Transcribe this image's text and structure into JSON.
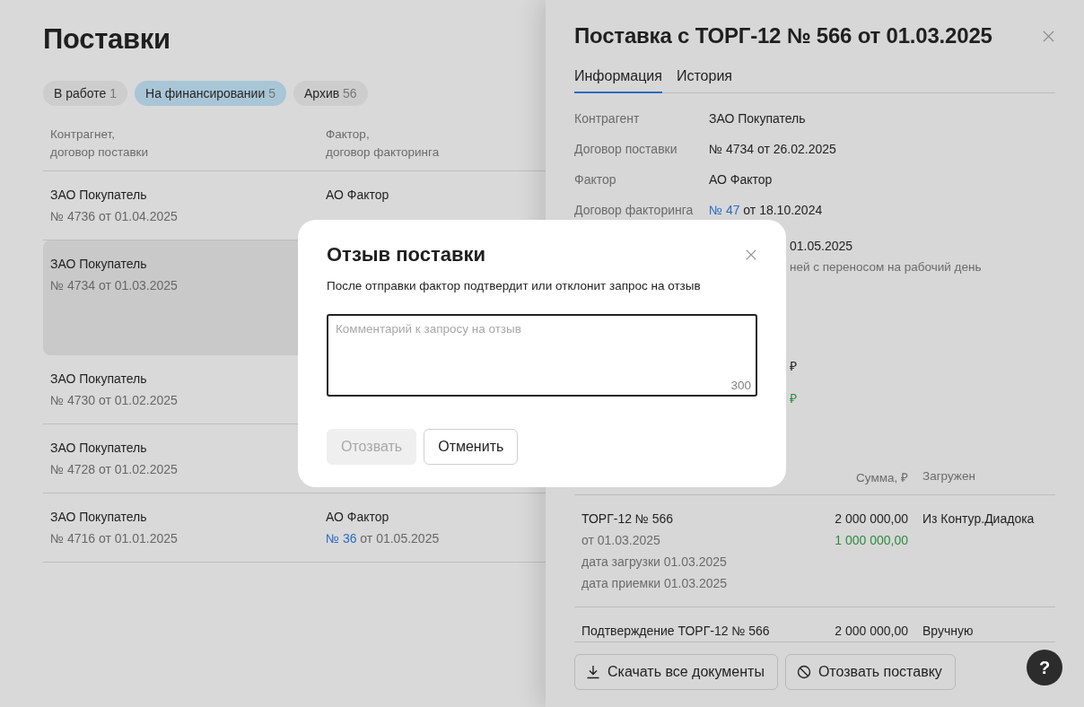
{
  "page": {
    "title": "Поставки"
  },
  "filters": [
    {
      "label": "В работе",
      "count": "1",
      "selected": false
    },
    {
      "label": "На финансировании",
      "count": "5",
      "selected": true
    },
    {
      "label": "Архив",
      "count": "56",
      "selected": false
    }
  ],
  "table": {
    "columns": [
      "Контрагнет,\nдоговор поставки",
      "Фактор,\nдоговор факторинга"
    ],
    "rows": [
      {
        "counterparty": "ЗАО Покупатель",
        "contract": "№ 4736 от 01.04.2025",
        "factor": "АО Фактор",
        "selected": false
      },
      {
        "counterparty": "ЗАО Покупатель",
        "contract": "№ 4734 от 01.03.2025",
        "selected": true
      },
      {
        "counterparty": "ЗАО Покупатель",
        "contract": "№ 4730 от 01.02.2025",
        "selected": false
      },
      {
        "counterparty": "ЗАО Покупатель",
        "contract": "№ 4728 от 01.02.2025",
        "selected": false
      },
      {
        "counterparty": "ЗАО Покупатель",
        "contract": "№ 4716 от 01.01.2025",
        "factor": "АО Фактор",
        "factoring_link": "№ 36",
        "factoring_rest": " от 01.05.2025",
        "selected": false
      }
    ]
  },
  "drawer": {
    "title": "Поставка с ТОРГ-12 № 566 от 01.03.2025",
    "tabs": [
      {
        "label": "Информация",
        "selected": true
      },
      {
        "label": "История",
        "selected": false
      }
    ],
    "fields": [
      {
        "label": "Контрагент",
        "value": "ЗАО Покупатель"
      },
      {
        "label": "Договор поставки",
        "value": "№ 4734 от 26.02.2025"
      },
      {
        "label": "Фактор",
        "value": "АО Фактор"
      },
      {
        "label": "Договор факторинга",
        "link": "№ 47",
        "value": " от 18.10.2024"
      }
    ],
    "fragments": [
      {
        "kind": "value",
        "text": "01.05.2025"
      },
      {
        "kind": "note",
        "text": "ней с переносом на рабочий день"
      },
      {
        "kind": "amount",
        "text": "₽"
      },
      {
        "kind": "funded",
        "text": "₽"
      }
    ],
    "documents": {
      "columns": [
        "Сумма, ₽",
        "Загружен"
      ],
      "rows": [
        {
          "name": "ТОРГ-12 № 566",
          "details": [
            "от 01.03.2025",
            "дата загрузки 01.03.2025",
            "дата приемки 01.03.2025"
          ],
          "amount": "2 000 000,00",
          "funded": "1 000 000,00",
          "source": "Из Контур.Диадока"
        },
        {
          "name": "Подтверждение ТОРГ-12 № 566",
          "details": [],
          "amount": "2 000 000,00",
          "source": "Вручную"
        }
      ]
    },
    "buttons": [
      {
        "kind": "download",
        "label": "Скачать все документы"
      },
      {
        "kind": "revoke",
        "label": "Отозвать поставку"
      }
    ]
  },
  "help_button": {
    "label": "?"
  },
  "dialog": {
    "title": "Отзыв поставки",
    "text": "После отправки фактор подтвердит или отклонит запрос на отзыв",
    "comment": {
      "placeholder": "Комментарий к запросу на отзыв",
      "limit": "300"
    },
    "buttons": [
      {
        "label": "Отозвать",
        "disabled": true
      },
      {
        "label": "Отменить",
        "disabled": false
      }
    ]
  }
}
